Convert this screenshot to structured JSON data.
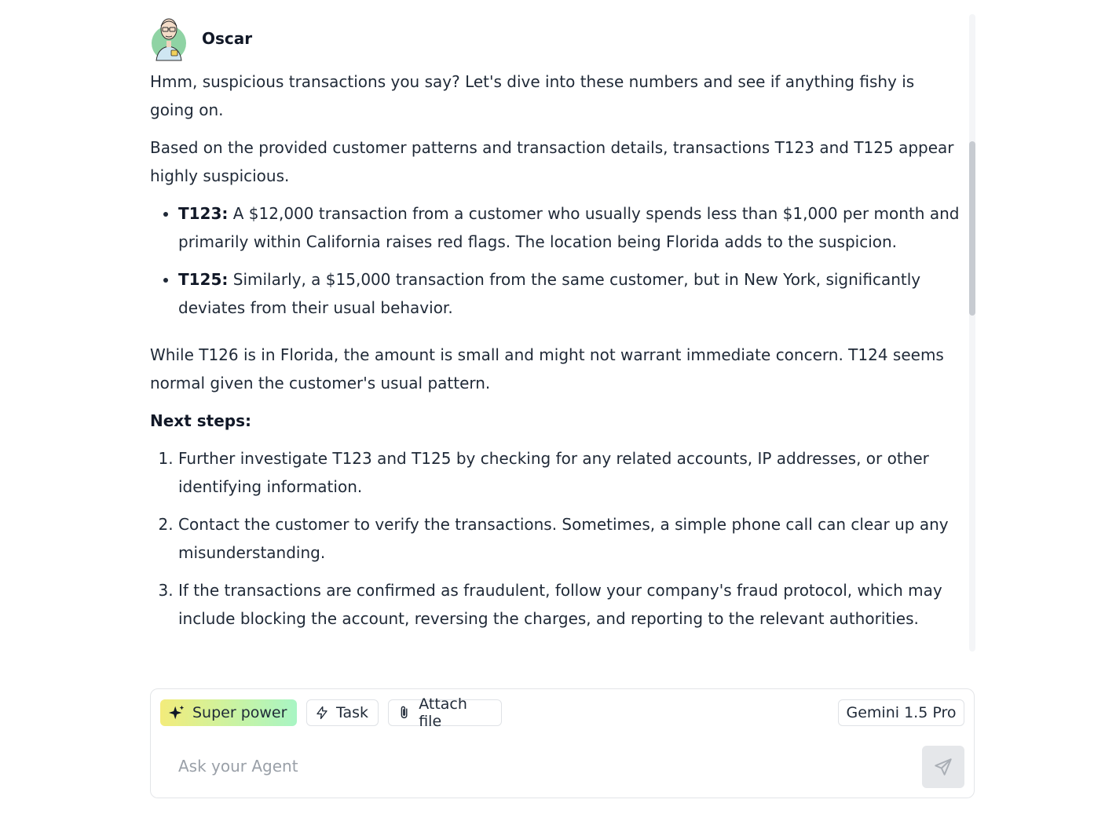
{
  "agent": {
    "name": "Oscar"
  },
  "message": {
    "intro": "Hmm, suspicious transactions you say? Let's dive into these numbers and see if anything fishy is going on.",
    "summary": "Based on the provided customer patterns and transaction details, transactions T123 and T125 appear highly suspicious.",
    "bullets": [
      {
        "label": "T123:",
        "text": " A $12,000 transaction from a customer who usually spends less than $1,000 per month and primarily within California raises red flags. The location being Florida adds to the suspicion."
      },
      {
        "label": "T125:",
        "text": " Similarly, a $15,000 transaction from the same customer, but in New York, significantly deviates from their usual behavior."
      }
    ],
    "note": "While T126 is in Florida, the amount is small and might not warrant immediate concern. T124 seems normal given the customer's usual pattern.",
    "next_steps_heading": "Next steps:",
    "steps": [
      "Further investigate T123 and T125 by checking for any related accounts, IP addresses, or other identifying information.",
      "Contact the customer to verify the transactions. Sometimes, a simple phone call can clear up any misunderstanding.",
      "If the transactions are confirmed as fraudulent, follow your company's fraud protocol, which may include blocking the account, reversing the charges, and reporting to the relevant authorities."
    ]
  },
  "composer": {
    "super_power_label": "Super power",
    "task_label": "Task",
    "attach_label": "Attach file",
    "model_label": "Gemini 1.5 Pro",
    "input_placeholder": "Ask your Agent",
    "input_value": ""
  },
  "icons": {
    "super_power": "sparkles-icon",
    "task": "lightning-icon",
    "attach": "paperclip-icon",
    "send": "paper-plane-icon"
  },
  "colors": {
    "super_power_gradient_start": "#f3ec7b",
    "super_power_gradient_end": "#a8f5c4",
    "send_button_bg": "#e5e7ea"
  }
}
